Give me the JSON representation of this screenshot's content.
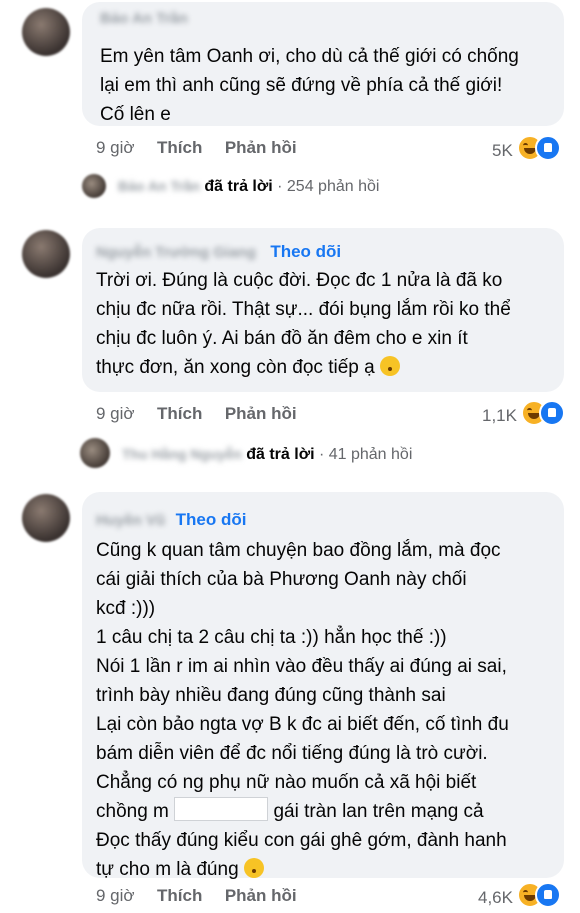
{
  "comments": [
    {
      "author": "Bảo An Trần",
      "text_lines": [
        "Em yên tâm Oanh ơi, cho dù cả thế giới có chống",
        "lại em thì anh cũng sẽ đứng về phía cả thế giới!",
        "Cố lên e"
      ],
      "time": "9 giờ",
      "like_label": "Thích",
      "reply_label": "Phản hồi",
      "reaction_count": "5K",
      "reactions": [
        "haha-icon",
        "like-icon"
      ],
      "replies": {
        "author": "Bảo An Trần",
        "action": "đã trả lời",
        "count": "· 254 phản hồi"
      }
    },
    {
      "author": "Nguyễn Trường Giang",
      "follow": "Theo dõi",
      "text_lines": [
        "Trời ơi. Đúng là cuộc đời. Đọc đc 1 nửa là đã ko",
        "chịu đc nữa rồi. Thật sự... đói bụng lắm rồi ko thể",
        "chịu đc luôn ý. Ai bán đồ ăn đêm cho e xin ít",
        "thực đơn, ăn xong còn đọc tiếp ạ"
      ],
      "time": "9 giờ",
      "like_label": "Thích",
      "reply_label": "Phản hồi",
      "reaction_count": "1,1K",
      "reactions": [
        "haha-icon",
        "like-icon"
      ],
      "replies": {
        "author": "Thu Hằng Nguyễn",
        "action": "đã trả lời",
        "count": "· 41 phản hồi"
      }
    },
    {
      "author": "Huyền Vũ",
      "follow": "Theo dõi",
      "text_lines": [
        "Cũng k quan tâm chuyện bao đồng lắm, mà đọc",
        "cái giải thích của bà Phương Oanh này chối",
        "kcđ :)))",
        "1 câu chị ta 2 câu chị ta :)) hẳn học thế :))",
        "Nói 1 lần r im ai nhìn vào đều thấy ai đúng ai sai,",
        "trình bày nhiều đang đúng cũng thành sai",
        "Lại còn bảo ngta vợ B k đc ai biết đến, cố tình đu",
        "bám diễn viên để đc nổi tiếng đúng là trò cười.",
        "Chẳng có ng phụ nữ nào muốn cả xã hội biết",
        "chồng m",
        "gái tràn lan trên mạng cả",
        "Đọc thấy đúng kiểu con gái ghê gớm, đành hanh",
        "tự cho m là đúng"
      ],
      "time": "9 giờ",
      "like_label": "Thích",
      "reply_label": "Phản hồi",
      "reaction_count": "4,6K",
      "reactions": [
        "haha-icon",
        "like-icon"
      ]
    }
  ]
}
